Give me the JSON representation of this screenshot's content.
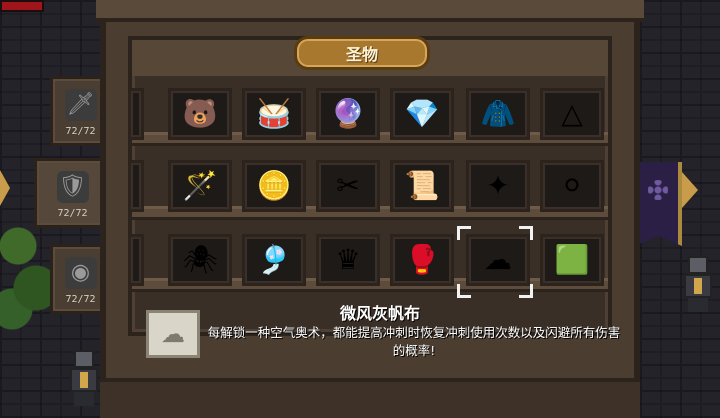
{
  "panel": {
    "title": "圣物"
  },
  "side_tabs": [
    {
      "icon": "sword-relic-icon",
      "glyph": "🗡",
      "count": "72/72"
    },
    {
      "icon": "shield-relic-icon",
      "glyph": "🛡",
      "count": "72/72"
    },
    {
      "icon": "orb-relic-icon",
      "glyph": "◉",
      "count": "72/72"
    }
  ],
  "relic_rows": [
    [
      {
        "name": "partial-relic-icon",
        "glyph": ""
      },
      {
        "name": "bear-relic-icon",
        "glyph": "🐻"
      },
      {
        "name": "drum-relic-icon",
        "glyph": "🥁"
      },
      {
        "name": "blue-orb-relic-icon",
        "glyph": "🔮"
      },
      {
        "name": "red-gem-relic-icon",
        "glyph": "💎"
      },
      {
        "name": "blue-cloak-relic-icon",
        "glyph": "🧥"
      },
      {
        "name": "triangle-relic-icon",
        "glyph": "△"
      }
    ],
    [
      {
        "name": "partial-relic-icon",
        "glyph": ""
      },
      {
        "name": "magic-wand-relic-icon",
        "glyph": "🪄"
      },
      {
        "name": "gold-coins-relic-icon",
        "glyph": "🪙"
      },
      {
        "name": "scissors-relic-icon",
        "glyph": "✂"
      },
      {
        "name": "scroll-relic-icon",
        "glyph": "📜"
      },
      {
        "name": "crystal-relic-icon",
        "glyph": "✦"
      },
      {
        "name": "silver-orb-relic-icon",
        "glyph": "⚪"
      }
    ],
    [
      {
        "name": "partial-relic-icon",
        "glyph": ""
      },
      {
        "name": "spider-relic-icon",
        "glyph": "🕷"
      },
      {
        "name": "chime-relic-icon",
        "glyph": "🎐"
      },
      {
        "name": "crown-relic-icon",
        "glyph": "♛"
      },
      {
        "name": "boxing-glove-relic-icon",
        "glyph": "🥊"
      },
      {
        "name": "gray-cloth-relic-icon",
        "glyph": "☁"
      },
      {
        "name": "green-gem-relic-icon",
        "glyph": "🟩"
      }
    ]
  ],
  "selected": {
    "name": "微风灰帆布",
    "description": "每解锁一种空气奥术，都能提高冲刺时恢复冲刺使用次数以及闪避所有伤害的概率!",
    "icon": "gray-cloth-relic-icon",
    "glyph": "☁"
  },
  "colors": {
    "wood": "#4b3d30",
    "plaque": "#a8782e",
    "text": "#ffffff"
  }
}
